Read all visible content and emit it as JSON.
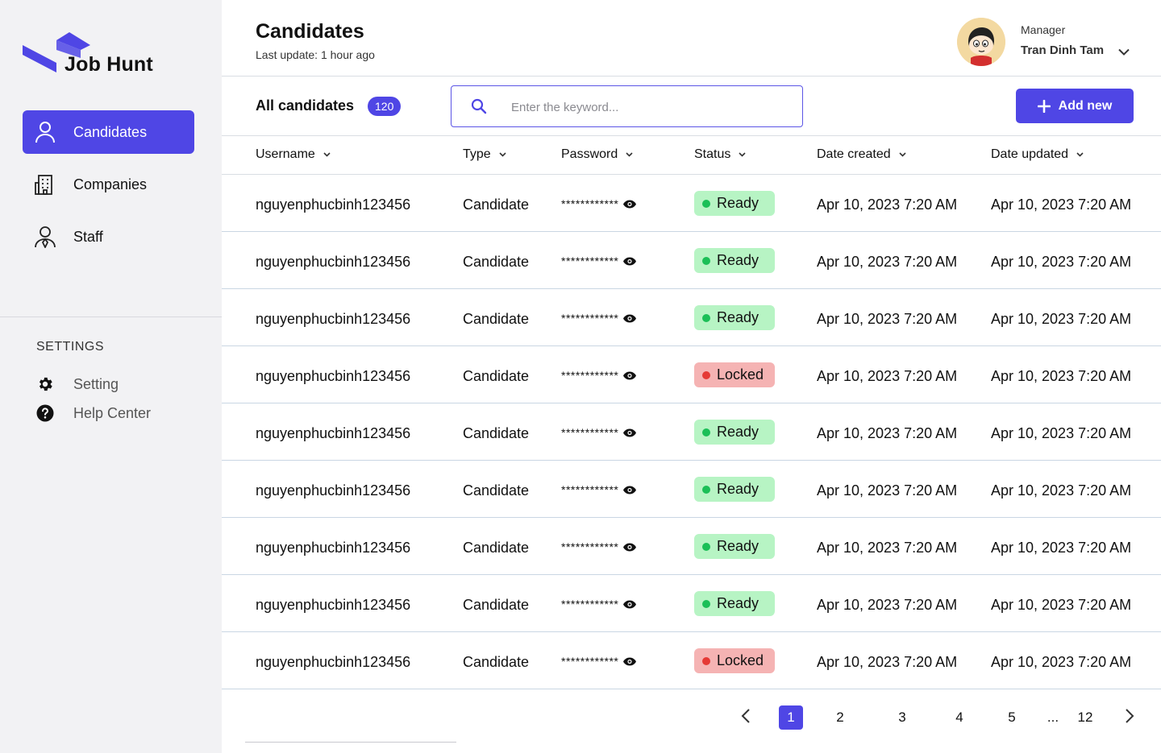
{
  "brand": {
    "name": "Job Hunt",
    "accent": "#4f46e5"
  },
  "sidebar": {
    "nav": [
      {
        "label": "Candidates",
        "icon": "user-icon",
        "active": true
      },
      {
        "label": "Companies",
        "icon": "building-icon",
        "active": false
      },
      {
        "label": "Staff",
        "icon": "staff-icon",
        "active": false
      }
    ],
    "settings_title": "SETTINGS",
    "settings": [
      {
        "label": "Setting",
        "icon": "gear-icon"
      },
      {
        "label": "Help Center",
        "icon": "help-icon"
      }
    ]
  },
  "header": {
    "title": "Candidates",
    "subtitle": "Last update: 1 hour ago",
    "user": {
      "role": "Manager",
      "name": "Tran Dinh Tam"
    }
  },
  "toolbar": {
    "all_label": "All candidates",
    "count": "120",
    "search_placeholder": "Enter the keyword...",
    "add_label": "Add new"
  },
  "table": {
    "columns": [
      "Username",
      "Type",
      "Password",
      "Status",
      "Date created",
      "Date updated"
    ],
    "rows": [
      {
        "username": "nguyenphucbinh123456",
        "type": "Candidate",
        "password": "************",
        "status": "Ready",
        "created": "Apr 10, 2023 7:20 AM",
        "updated": "Apr 10, 2023 7:20 AM"
      },
      {
        "username": "nguyenphucbinh123456",
        "type": "Candidate",
        "password": "************",
        "status": "Ready",
        "created": "Apr 10, 2023 7:20 AM",
        "updated": "Apr 10, 2023 7:20 AM"
      },
      {
        "username": "nguyenphucbinh123456",
        "type": "Candidate",
        "password": "************",
        "status": "Ready",
        "created": "Apr 10, 2023 7:20 AM",
        "updated": "Apr 10, 2023 7:20 AM"
      },
      {
        "username": "nguyenphucbinh123456",
        "type": "Candidate",
        "password": "************",
        "status": "Locked",
        "created": "Apr 10, 2023 7:20 AM",
        "updated": "Apr 10, 2023 7:20 AM"
      },
      {
        "username": "nguyenphucbinh123456",
        "type": "Candidate",
        "password": "************",
        "status": "Ready",
        "created": "Apr 10, 2023 7:20 AM",
        "updated": "Apr 10, 2023 7:20 AM"
      },
      {
        "username": "nguyenphucbinh123456",
        "type": "Candidate",
        "password": "************",
        "status": "Ready",
        "created": "Apr 10, 2023 7:20 AM",
        "updated": "Apr 10, 2023 7:20 AM"
      },
      {
        "username": "nguyenphucbinh123456",
        "type": "Candidate",
        "password": "************",
        "status": "Ready",
        "created": "Apr 10, 2023 7:20 AM",
        "updated": "Apr 10, 2023 7:20 AM"
      },
      {
        "username": "nguyenphucbinh123456",
        "type": "Candidate",
        "password": "************",
        "status": "Ready",
        "created": "Apr 10, 2023 7:20 AM",
        "updated": "Apr 10, 2023 7:20 AM"
      },
      {
        "username": "nguyenphucbinh123456",
        "type": "Candidate",
        "password": "************",
        "status": "Locked",
        "created": "Apr 10, 2023 7:20 AM",
        "updated": "Apr 10, 2023 7:20 AM"
      }
    ]
  },
  "pagination": {
    "pages": [
      "1",
      "2",
      "3",
      "4",
      "5",
      "...",
      "12"
    ],
    "current": "1"
  }
}
